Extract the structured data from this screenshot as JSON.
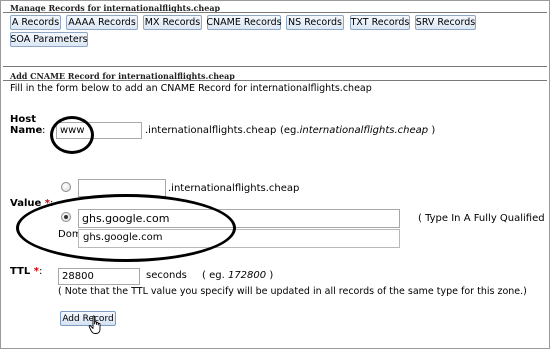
{
  "manage": {
    "title": "Manage Records for internationalflights.cheap",
    "tabs": [
      "A Records",
      "AAAA Records",
      "MX Records",
      "CNAME Records",
      "NS Records",
      "TXT Records",
      "SRV Records",
      "SOA Parameters"
    ]
  },
  "form": {
    "title": "Add CNAME Record for internationalflights.cheap",
    "instruction": "Fill in the form below to add an CNAME Record for internationalflights.cheap",
    "host": {
      "label": "Host Name",
      "label_line1": "Host",
      "label_line2": "Name",
      "colon": ":",
      "value": "www",
      "suffix": ".internationalflights.cheap",
      "example_prefix": "(eg.",
      "example": "internationalflights.cheap",
      "example_suffix": ")"
    },
    "value": {
      "label": "Value",
      "required_mark": "*",
      "colon": ":",
      "option1_value": "",
      "option1_suffix": ".internationalflights.cheap",
      "option2_value": "ghs.google.com",
      "hint": "( Type In A Fully Qualified",
      "hint_overflow": "Dom",
      "autocomplete": "ghs.google.com"
    },
    "ttl": {
      "label": "TTL",
      "required_mark": "*",
      "colon": ":",
      "value": "28800",
      "unit": "seconds",
      "example_prefix": "( eg.",
      "example": "172800",
      "example_suffix": ")",
      "note": "( Note that the TTL value you specify will be updated in all records of the same type for this zone.)"
    },
    "submit_label": "Add Record"
  },
  "colors": {
    "button_border": "#8fa7c4",
    "required": "#cc0000",
    "annotation": "#000000"
  }
}
